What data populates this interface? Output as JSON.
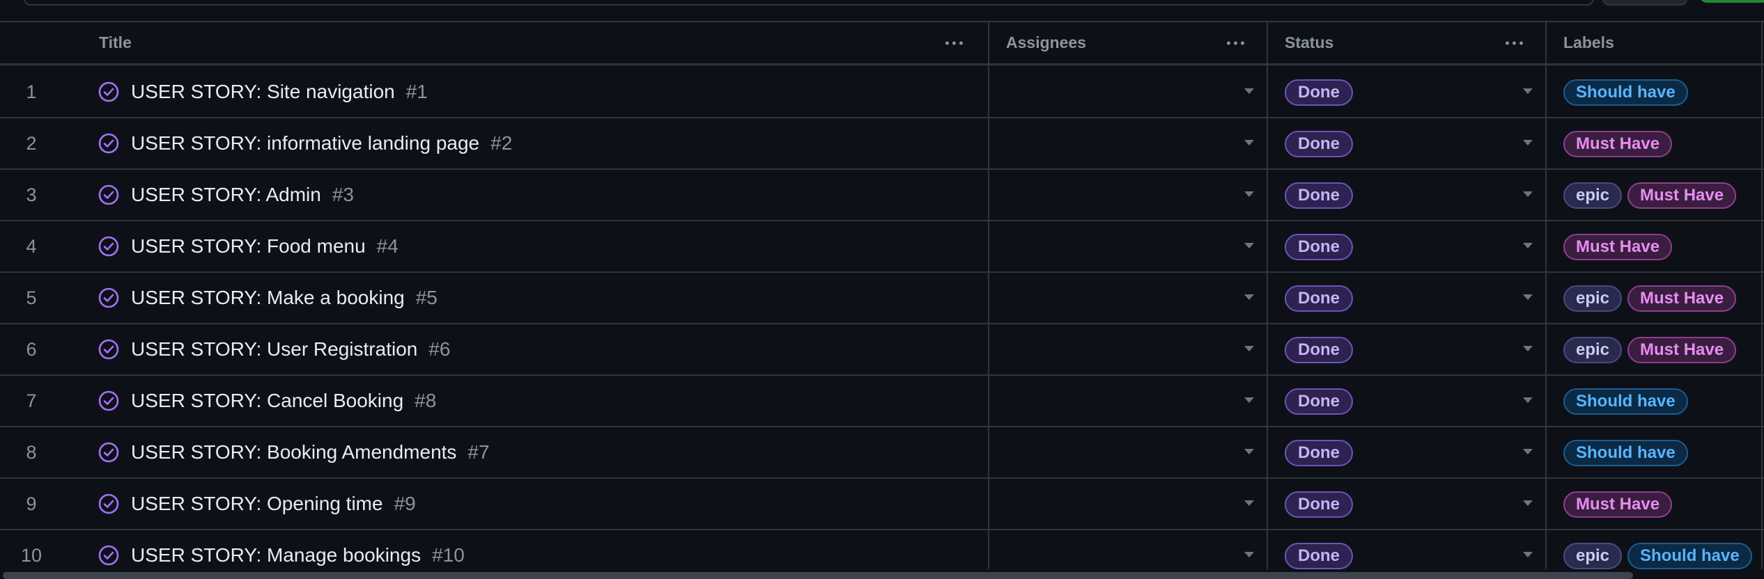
{
  "columns": {
    "title": "Title",
    "assignees": "Assignees",
    "status": "Status",
    "labels": "Labels"
  },
  "rows": [
    {
      "num": "1",
      "title": "USER STORY: Site navigation",
      "issue": "#1",
      "status": "Done",
      "labels": [
        {
          "text": "Should have",
          "kind": "should"
        }
      ]
    },
    {
      "num": "2",
      "title": "USER STORY: informative landing page",
      "issue": "#2",
      "status": "Done",
      "labels": [
        {
          "text": "Must Have",
          "kind": "must"
        }
      ]
    },
    {
      "num": "3",
      "title": "USER STORY: Admin",
      "issue": "#3",
      "status": "Done",
      "labels": [
        {
          "text": "epic",
          "kind": "epic"
        },
        {
          "text": "Must Have",
          "kind": "must"
        }
      ]
    },
    {
      "num": "4",
      "title": "USER STORY: Food menu",
      "issue": "#4",
      "status": "Done",
      "labels": [
        {
          "text": "Must Have",
          "kind": "must"
        }
      ]
    },
    {
      "num": "5",
      "title": "USER STORY: Make a booking",
      "issue": "#5",
      "status": "Done",
      "labels": [
        {
          "text": "epic",
          "kind": "epic"
        },
        {
          "text": "Must Have",
          "kind": "must"
        }
      ]
    },
    {
      "num": "6",
      "title": "USER STORY: User Registration",
      "issue": "#6",
      "status": "Done",
      "labels": [
        {
          "text": "epic",
          "kind": "epic"
        },
        {
          "text": "Must Have",
          "kind": "must"
        }
      ]
    },
    {
      "num": "7",
      "title": "USER STORY: Cancel Booking",
      "issue": "#8",
      "status": "Done",
      "labels": [
        {
          "text": "Should have",
          "kind": "should"
        }
      ]
    },
    {
      "num": "8",
      "title": "USER STORY: Booking Amendments",
      "issue": "#7",
      "status": "Done",
      "labels": [
        {
          "text": "Should have",
          "kind": "should"
        }
      ]
    },
    {
      "num": "9",
      "title": "USER STORY: Opening time",
      "issue": "#9",
      "status": "Done",
      "labels": [
        {
          "text": "Must Have",
          "kind": "must"
        }
      ]
    },
    {
      "num": "10",
      "title": "USER STORY: Manage bookings",
      "issue": "#10",
      "status": "Done",
      "labels": [
        {
          "text": "epic",
          "kind": "epic"
        },
        {
          "text": "Should have",
          "kind": "should"
        }
      ]
    }
  ],
  "icons": {
    "issue_closed": "check-circle-icon",
    "column_menu": "kebab-horizontal-icon",
    "dropdown": "triangle-down-icon"
  },
  "colors": {
    "background": "#0d1117",
    "border": "#30363d",
    "done_accent": "#a371f7",
    "should_have": "#58b4ff",
    "must_have": "#e58df0"
  }
}
